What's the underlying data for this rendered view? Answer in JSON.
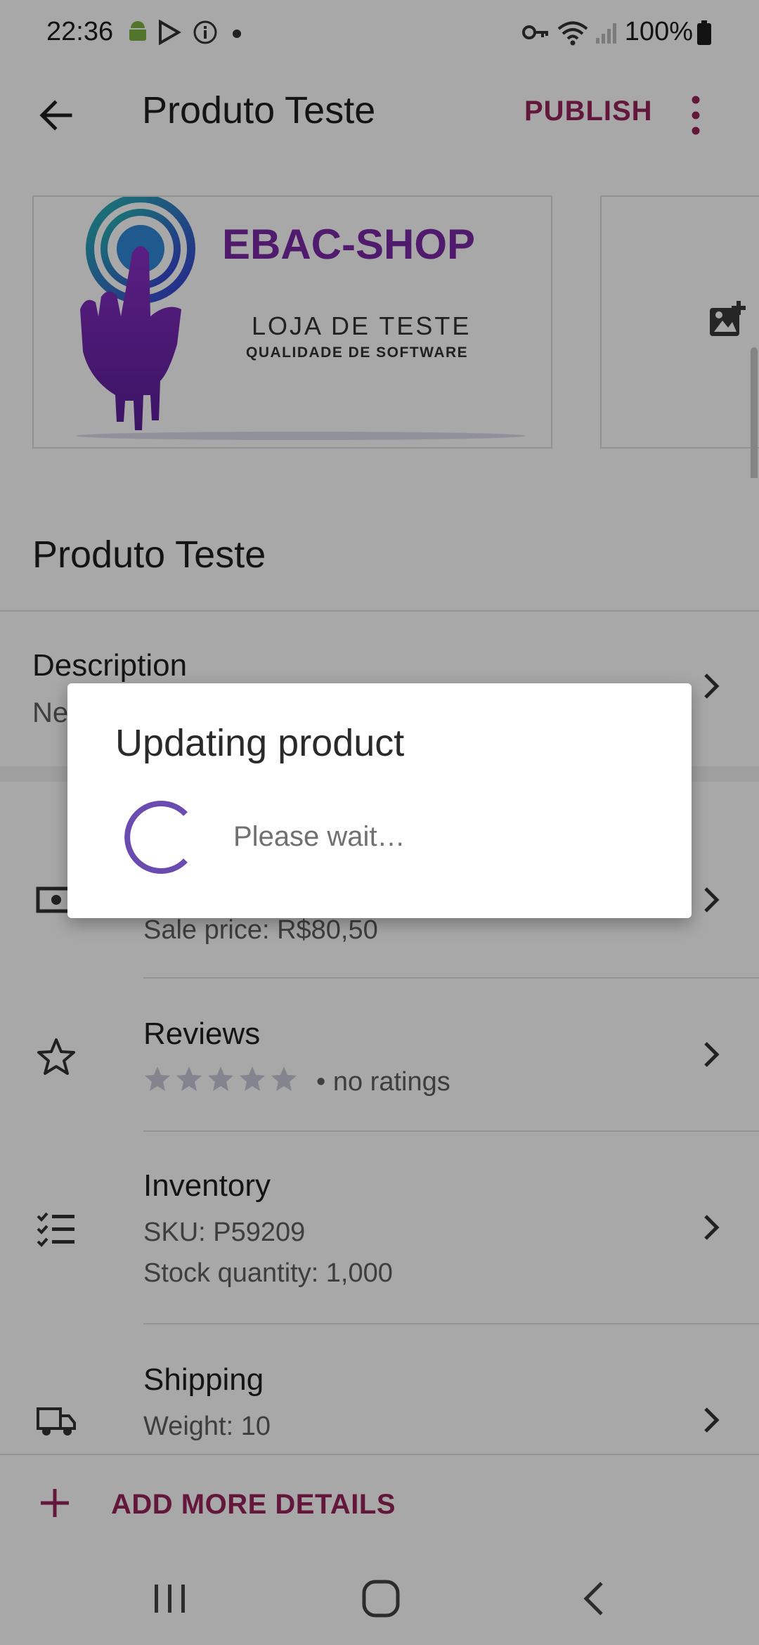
{
  "status_bar": {
    "time": "22:36",
    "battery": "100%",
    "icons": [
      "android-icon",
      "play-store-icon",
      "info-icon",
      "dot-icon",
      "vpn-key-icon",
      "wifi-icon",
      "signal-icon",
      "battery-icon"
    ]
  },
  "appbar": {
    "title": "Produto Teste",
    "publish_label": "PUBLISH",
    "accent_color": "#96255a"
  },
  "images": {
    "banner_brand": "EBAC-SHOP",
    "banner_line1": "LOJA DE TESTE",
    "banner_line2": "QUALIDADE DE SOFTWARE"
  },
  "product": {
    "name": "Produto Teste",
    "description_label": "Description",
    "description_preview": "Ne"
  },
  "rows": {
    "price": {
      "sub": "Sale price: R$80,50"
    },
    "reviews": {
      "title": "Reviews",
      "rating_text": "• no ratings",
      "stars": 5
    },
    "inventory": {
      "title": "Inventory",
      "sku": "SKU: P59209",
      "stock": "Stock quantity: 1,000"
    },
    "shipping": {
      "title": "Shipping",
      "weight": "Weight: 10"
    }
  },
  "add_more_label": "ADD MORE DETAILS",
  "dialog": {
    "title": "Updating product",
    "message": "Please wait…",
    "spinner_color": "#6a4bb0"
  }
}
